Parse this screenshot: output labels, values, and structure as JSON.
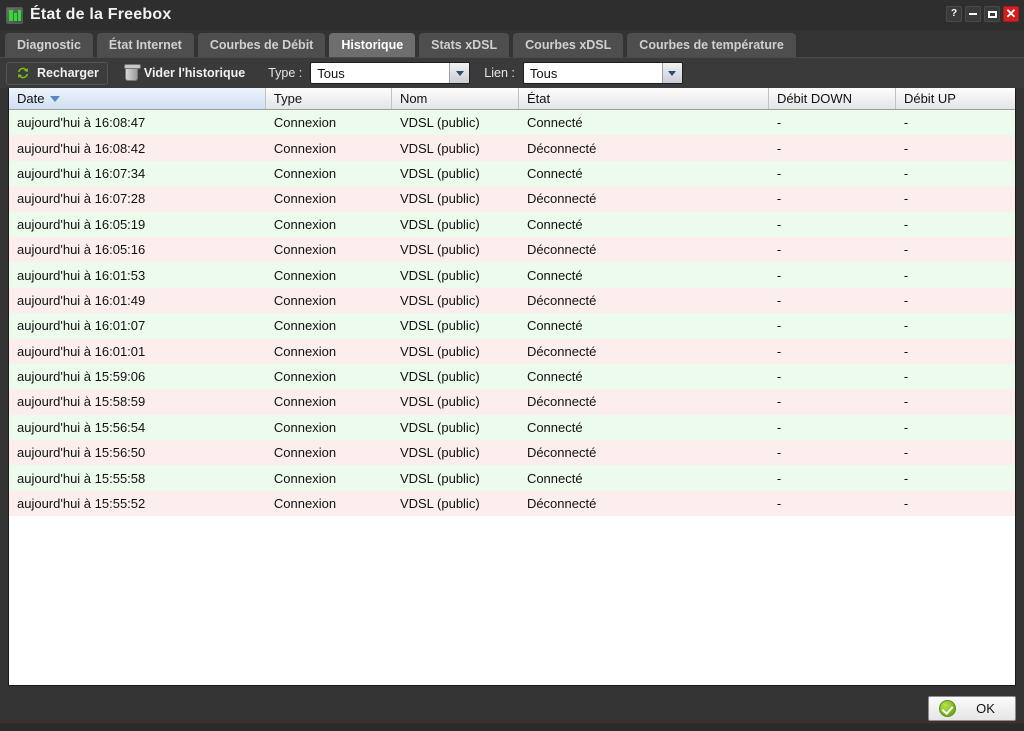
{
  "window": {
    "title": "État de la Freebox",
    "app_icon": "freebox-icon",
    "controls": [
      {
        "name": "help-button",
        "glyph": "?"
      },
      {
        "name": "minimize-button",
        "glyph": ""
      },
      {
        "name": "maximize-button",
        "glyph": ""
      },
      {
        "name": "close-button",
        "glyph": "✕"
      }
    ]
  },
  "tabs": [
    {
      "label": "Diagnostic",
      "active": false
    },
    {
      "label": "État Internet",
      "active": false
    },
    {
      "label": "Courbes de Débit",
      "active": false
    },
    {
      "label": "Historique",
      "active": true
    },
    {
      "label": "Stats xDSL",
      "active": false
    },
    {
      "label": "Courbes xDSL",
      "active": false
    },
    {
      "label": "Courbes de température",
      "active": false
    }
  ],
  "toolbar": {
    "reload_label": "Recharger",
    "reload_icon": "refresh-icon",
    "clear_label": "Vider l'historique",
    "clear_icon": "trash-icon",
    "type_label": "Type :",
    "type_value": "Tous",
    "link_label": "Lien :",
    "link_value": "Tous"
  },
  "table": {
    "columns": [
      {
        "key": "date",
        "label": "Date",
        "sorted": true,
        "sort_dir": "desc"
      },
      {
        "key": "type",
        "label": "Type",
        "sorted": false,
        "sort_dir": ""
      },
      {
        "key": "nom",
        "label": "Nom",
        "sorted": false,
        "sort_dir": ""
      },
      {
        "key": "etat",
        "label": "État",
        "sorted": false,
        "sort_dir": ""
      },
      {
        "key": "down",
        "label": "Débit DOWN",
        "sorted": false,
        "sort_dir": ""
      },
      {
        "key": "up",
        "label": "Débit UP",
        "sorted": false,
        "sort_dir": ""
      }
    ],
    "rows": [
      {
        "date": "aujourd'hui à 16:08:47",
        "type": "Connexion",
        "nom": "VDSL (public)",
        "etat": "Connecté",
        "down": "-",
        "up": "-",
        "state": "connected"
      },
      {
        "date": "aujourd'hui à 16:08:42",
        "type": "Connexion",
        "nom": "VDSL (public)",
        "etat": "Déconnecté",
        "down": "-",
        "up": "-",
        "state": "disconnected"
      },
      {
        "date": "aujourd'hui à 16:07:34",
        "type": "Connexion",
        "nom": "VDSL (public)",
        "etat": "Connecté",
        "down": "-",
        "up": "-",
        "state": "connected"
      },
      {
        "date": "aujourd'hui à 16:07:28",
        "type": "Connexion",
        "nom": "VDSL (public)",
        "etat": "Déconnecté",
        "down": "-",
        "up": "-",
        "state": "disconnected"
      },
      {
        "date": "aujourd'hui à 16:05:19",
        "type": "Connexion",
        "nom": "VDSL (public)",
        "etat": "Connecté",
        "down": "-",
        "up": "-",
        "state": "connected"
      },
      {
        "date": "aujourd'hui à 16:05:16",
        "type": "Connexion",
        "nom": "VDSL (public)",
        "etat": "Déconnecté",
        "down": "-",
        "up": "-",
        "state": "disconnected"
      },
      {
        "date": "aujourd'hui à 16:01:53",
        "type": "Connexion",
        "nom": "VDSL (public)",
        "etat": "Connecté",
        "down": "-",
        "up": "-",
        "state": "connected"
      },
      {
        "date": "aujourd'hui à 16:01:49",
        "type": "Connexion",
        "nom": "VDSL (public)",
        "etat": "Déconnecté",
        "down": "-",
        "up": "-",
        "state": "disconnected"
      },
      {
        "date": "aujourd'hui à 16:01:07",
        "type": "Connexion",
        "nom": "VDSL (public)",
        "etat": "Connecté",
        "down": "-",
        "up": "-",
        "state": "connected"
      },
      {
        "date": "aujourd'hui à 16:01:01",
        "type": "Connexion",
        "nom": "VDSL (public)",
        "etat": "Déconnecté",
        "down": "-",
        "up": "-",
        "state": "disconnected"
      },
      {
        "date": "aujourd'hui à 15:59:06",
        "type": "Connexion",
        "nom": "VDSL (public)",
        "etat": "Connecté",
        "down": "-",
        "up": "-",
        "state": "connected"
      },
      {
        "date": "aujourd'hui à 15:58:59",
        "type": "Connexion",
        "nom": "VDSL (public)",
        "etat": "Déconnecté",
        "down": "-",
        "up": "-",
        "state": "disconnected"
      },
      {
        "date": "aujourd'hui à 15:56:54",
        "type": "Connexion",
        "nom": "VDSL (public)",
        "etat": "Connecté",
        "down": "-",
        "up": "-",
        "state": "connected"
      },
      {
        "date": "aujourd'hui à 15:56:50",
        "type": "Connexion",
        "nom": "VDSL (public)",
        "etat": "Déconnecté",
        "down": "-",
        "up": "-",
        "state": "disconnected"
      },
      {
        "date": "aujourd'hui à 15:55:58",
        "type": "Connexion",
        "nom": "VDSL (public)",
        "etat": "Connecté",
        "down": "-",
        "up": "-",
        "state": "connected"
      },
      {
        "date": "aujourd'hui à 15:55:52",
        "type": "Connexion",
        "nom": "VDSL (public)",
        "etat": "Déconnecté",
        "down": "-",
        "up": "-",
        "state": "disconnected"
      }
    ]
  },
  "footer": {
    "ok_label": "OK",
    "ok_icon": "green-check-icon"
  },
  "colors": {
    "connected_row": "#ecfbec",
    "disconnected_row": "#fdeeee",
    "sorted_header": "#cfe0f3",
    "accent_green": "#7ac514",
    "close_red": "#d41f1f",
    "chrome_dark": "#333333"
  }
}
